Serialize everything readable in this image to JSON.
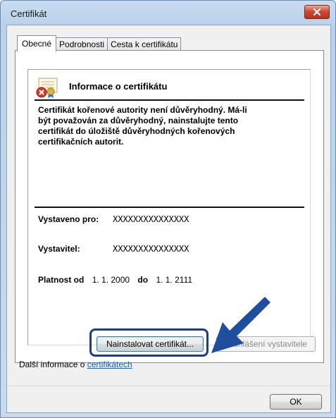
{
  "window": {
    "title": "Certifikát"
  },
  "tabs": [
    {
      "label": "Obecné",
      "active": true
    },
    {
      "label": "Podrobnosti",
      "active": false
    },
    {
      "label": "Cesta k certifikátu",
      "active": false
    }
  ],
  "info": {
    "heading": "Informace o certifikátu",
    "warning_lines": [
      "Certifikát kořenové autority není důvěryhodný. Má-li",
      "být považován za důvěryhodný, nainstalujte tento",
      "certifikát do úložiště důvěryhodných kořenových",
      "certifikačních autorit."
    ],
    "issued_to_label": "Vystaveno pro:",
    "issued_to_value": "XXXXXXXXXXXXXXX",
    "issuer_label": "Vystavitel:",
    "issuer_value": "XXXXXXXXXXXXXXX",
    "validity_from_label": "Platnost od",
    "validity_from_value": "1. 1. 2000",
    "validity_to_label": "do",
    "validity_to_value": "1. 1. 2111"
  },
  "buttons": {
    "install": "Nainstalovat certifikát...",
    "issuer_statement": "Prohlášení vystavitele",
    "ok": "OK"
  },
  "more_info": {
    "prefix": "Další informace o ",
    "link": "certifikátech"
  },
  "colors": {
    "highlight": "#1f3a8a",
    "arrow": "#1f4e9e",
    "link": "#0066cc"
  },
  "icons": [
    "close-icon",
    "certificate-error-icon",
    "pointer-arrow-icon"
  ]
}
